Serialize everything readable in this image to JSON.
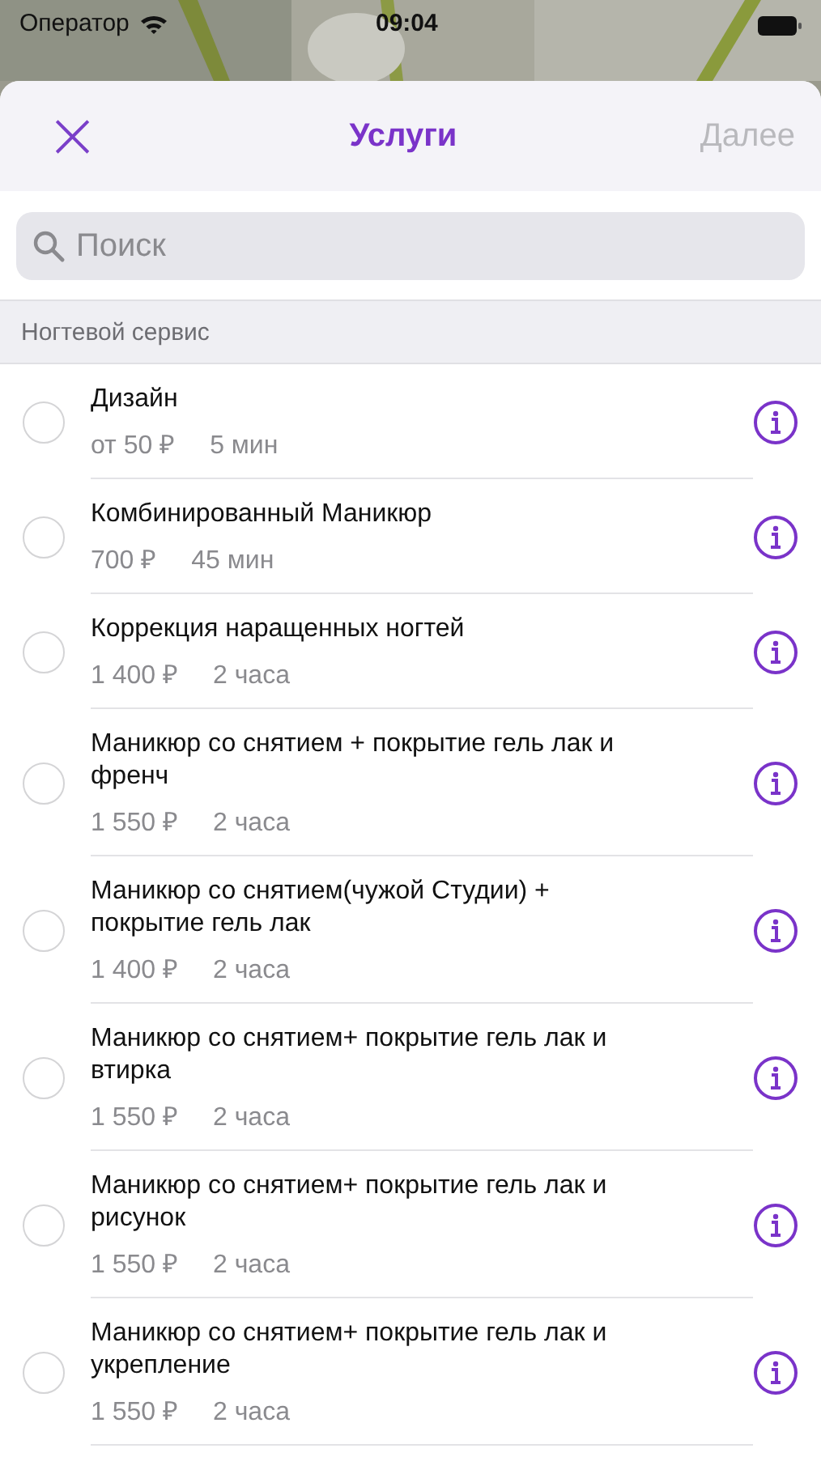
{
  "status_bar": {
    "carrier": "Оператор",
    "time": "09:04"
  },
  "header": {
    "close": "×",
    "title": "Услуги",
    "next": {
      "label": "Далее",
      "disabled": true
    }
  },
  "search": {
    "placeholder": "Поиск"
  },
  "section": {
    "title": "Ногтевой сервис"
  },
  "services": [
    {
      "name": "Дизайн",
      "price": "от 50 ₽",
      "duration": "5 мин",
      "selected": false
    },
    {
      "name": "Комбинированный Маникюр",
      "price": "700 ₽",
      "duration": "45 мин",
      "selected": false
    },
    {
      "name": "Коррекция наращенных ногтей",
      "price": "1 400 ₽",
      "duration": "2 часа",
      "selected": false
    },
    {
      "name": "Маникюр со снятием + покрытие гель лак и френч",
      "price": "1 550 ₽",
      "duration": "2 часа",
      "selected": false
    },
    {
      "name": "Маникюр со снятием(чужой Студии) + покрытие гель лак",
      "price": "1 400 ₽",
      "duration": "2 часа",
      "selected": false
    },
    {
      "name": "Маникюр со снятием+ покрытие гель лак и втирка",
      "price": "1 550 ₽",
      "duration": "2 часа",
      "selected": false
    },
    {
      "name": "Маникюр со снятием+ покрытие гель лак и рисунок",
      "price": "1 550 ₽",
      "duration": "2 часа",
      "selected": false
    },
    {
      "name": "Маникюр со снятием+ покрытие гель лак и укрепление",
      "price": "1 550 ₽",
      "duration": "2 часа",
      "selected": false
    }
  ]
}
